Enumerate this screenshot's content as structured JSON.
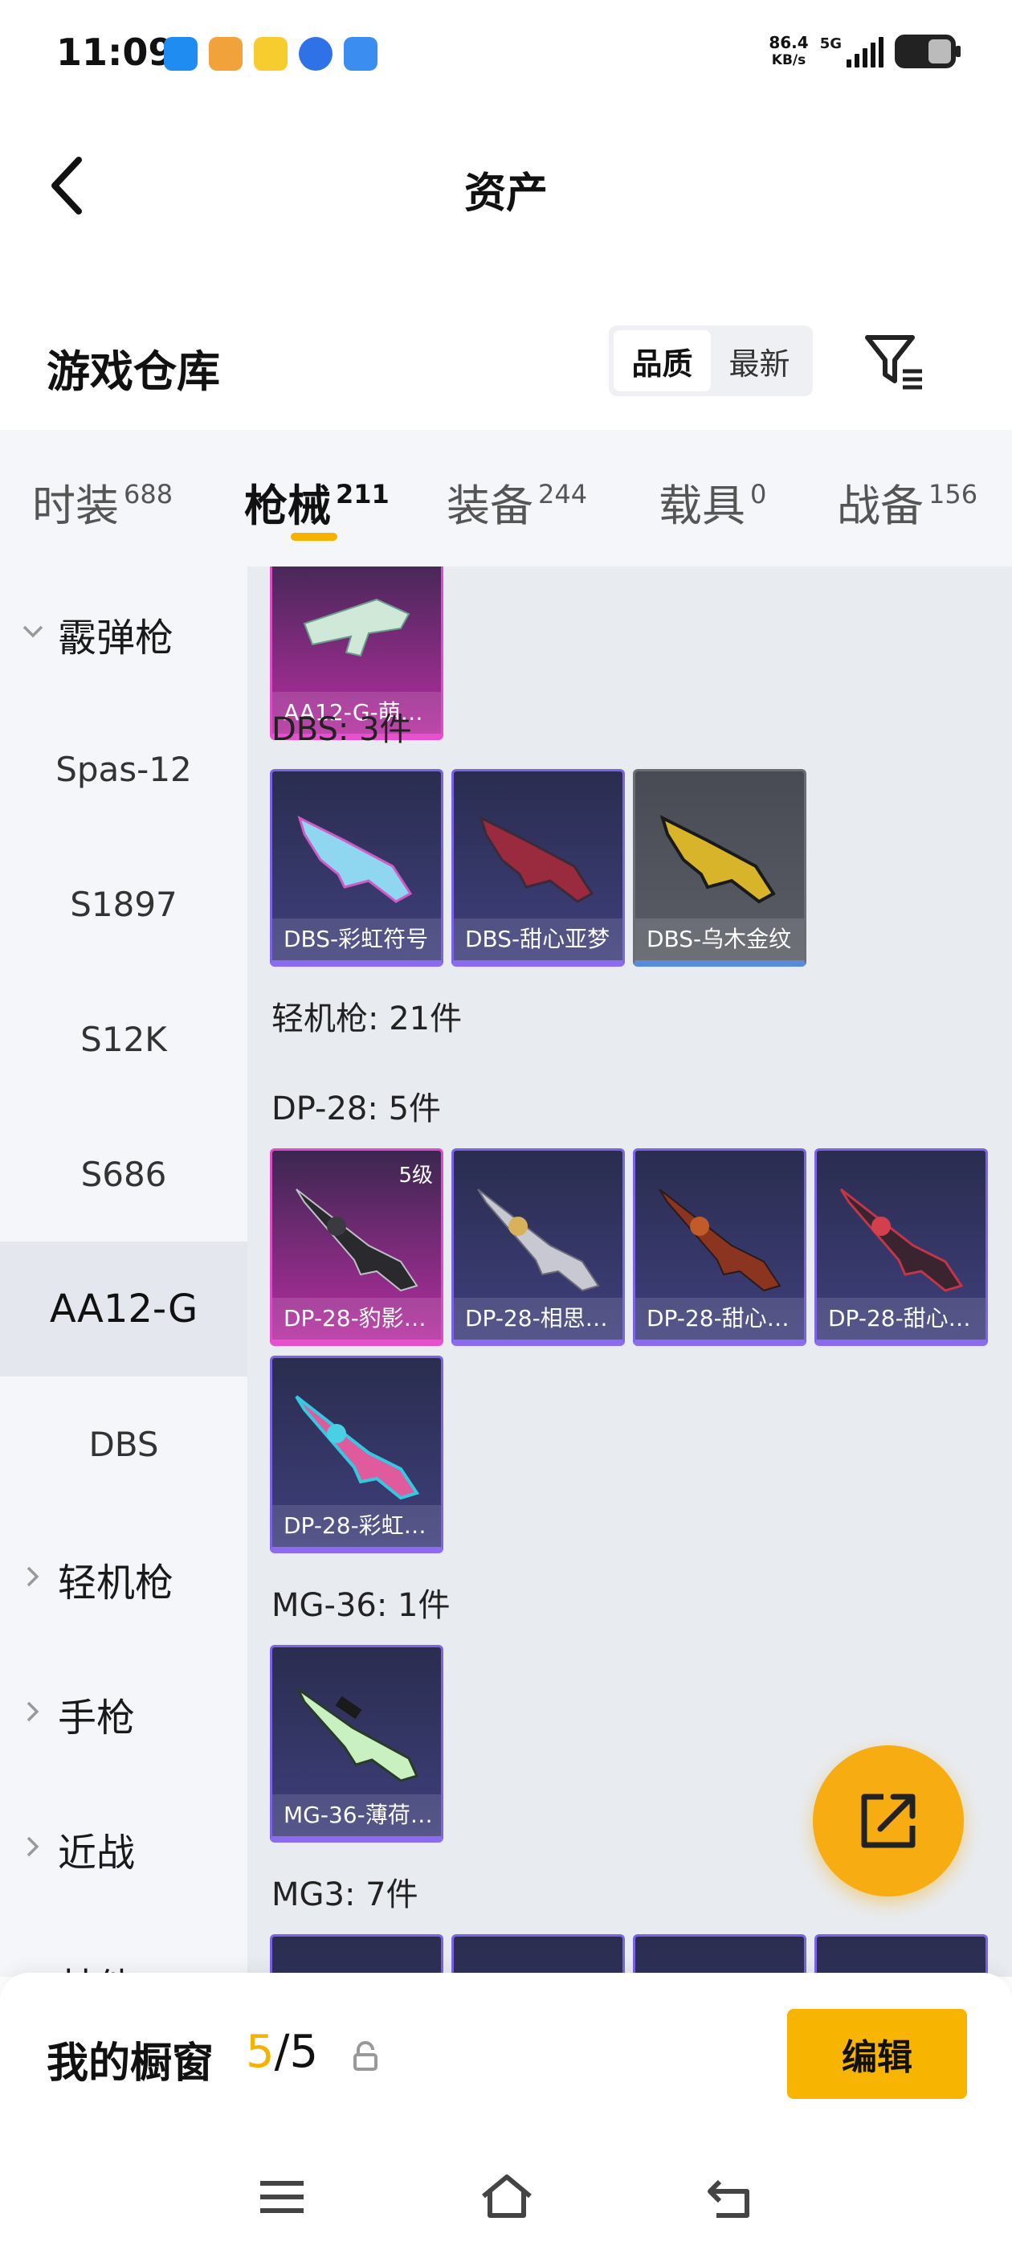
{
  "status": {
    "time": "11:09",
    "net_speed_value": "86.4",
    "net_speed_unit": "KB/s",
    "network": "5G"
  },
  "header": {
    "title": "资产"
  },
  "warehouse": {
    "title": "游戏仓库",
    "sort_options": [
      "品质",
      "最新"
    ],
    "sort_active": "品质"
  },
  "tabs": [
    {
      "label": "时装",
      "count": "688"
    },
    {
      "label": "枪械",
      "count": "211"
    },
    {
      "label": "装备",
      "count": "244"
    },
    {
      "label": "载具",
      "count": "0"
    },
    {
      "label": "战备",
      "count": "156"
    }
  ],
  "sidebar": {
    "group_shotgun": "霰弹枪",
    "items": [
      "Spas-12",
      "S1897",
      "S12K",
      "S686",
      "AA12-G",
      "DBS"
    ],
    "active": "AA12-G",
    "groups": [
      "轻机枪",
      "手枪",
      "近战",
      "其他"
    ]
  },
  "content": {
    "aa12_card": "AA12-G-萌…",
    "dbs_label": "DBS: 3件",
    "dbs_cards": [
      "DBS-彩虹符号",
      "DBS-甜心亚梦",
      "DBS-乌木金纹"
    ],
    "lmg_label": "轻机枪: 21件",
    "dp28_label": "DP-28: 5件",
    "dp28_cards": [
      "DP-28-豹影…",
      "DP-28-相思…",
      "DP-28-甜心…",
      "DP-28-甜心…",
      "DP-28-彩虹…"
    ],
    "dp28_level": "5级",
    "mg36_label": "MG-36: 1件",
    "mg36_cards": [
      "MG-36-薄荷…"
    ],
    "mg3_label": "MG3: 7件"
  },
  "showcase": {
    "label": "我的橱窗",
    "current": "5",
    "total": "/5",
    "edit_label": "编辑"
  },
  "colors": {
    "accent": "#f7b400",
    "purple_rarity": "#7b62e6",
    "pink_rarity": "#e04bc7"
  }
}
